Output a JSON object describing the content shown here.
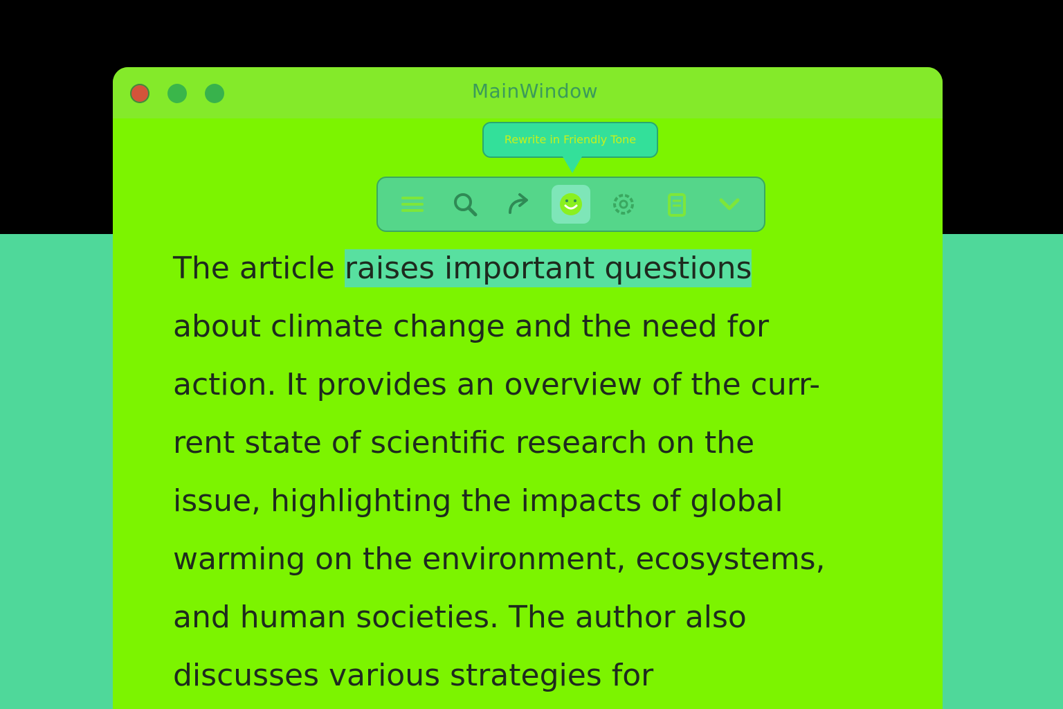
{
  "window": {
    "title": "MainWindow"
  },
  "tooltip": {
    "text": "Rewrite in Friendly Tone"
  },
  "toolbar": {
    "items": [
      {
        "icon": "menu-icon"
      },
      {
        "icon": "search-icon"
      },
      {
        "icon": "share-icon"
      },
      {
        "icon": "smile-icon"
      },
      {
        "icon": "settings-icon"
      },
      {
        "icon": "clipboard-icon"
      },
      {
        "icon": "chevron-down-icon"
      }
    ]
  },
  "document": {
    "lines": [
      {
        "before": "The article ",
        "highlight": "raises important questions",
        "after": ""
      },
      {
        "text": "about climate change and the need for"
      },
      {
        "text": "action. It provides an overview of the curr-"
      },
      {
        "text": "rent state of scientific research on the"
      },
      {
        "text": "issue, highlighting the impacts of global"
      },
      {
        "text": "warming on the environment, ecosystems,"
      },
      {
        "text": "and human societies. The author also"
      },
      {
        "text": "discusses various strategies for"
      }
    ]
  },
  "colors": {
    "window_bg": "#7cf400",
    "titlebar_bg": "#84ea2a",
    "highlight": "#58e0a0",
    "toolbar_bg": "#55d68a"
  }
}
